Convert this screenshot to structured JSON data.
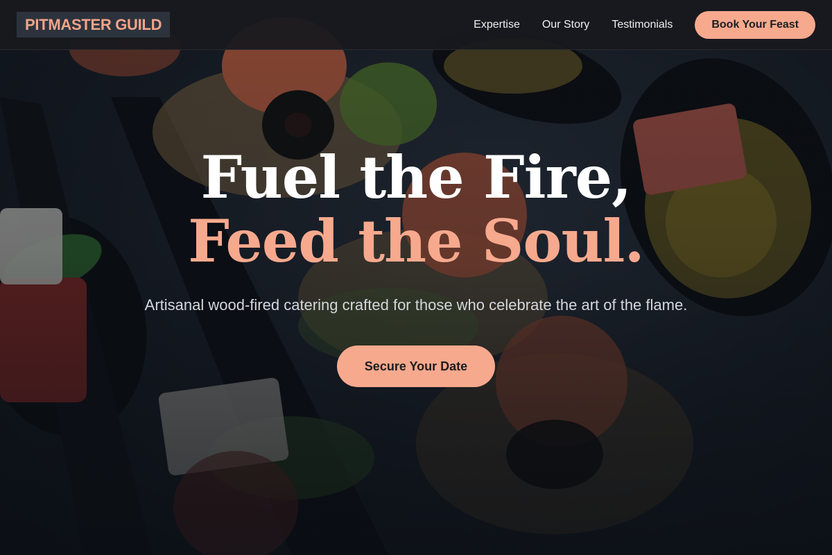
{
  "nav": {
    "brand": "PITMASTER GUILD",
    "links": [
      "Expertise",
      "Our Story",
      "Testimonials"
    ],
    "cta_label": "Book Your Feast"
  },
  "hero": {
    "headline_line1": "Fuel the Fire,",
    "headline_line2": "Feed the Soul.",
    "subtitle": "Artisanal wood-fired catering crafted for those who celebrate the art of the flame.",
    "cta_label": "Secure Your Date",
    "background_image": "canapés on black spoons over dark slate"
  },
  "colors": {
    "accent": "#f7a98e",
    "nav_background": "#181a1e",
    "brand_badge_background": "#2c333d",
    "headline_primary": "#ffffff",
    "subtitle": "#d4d7dc"
  }
}
